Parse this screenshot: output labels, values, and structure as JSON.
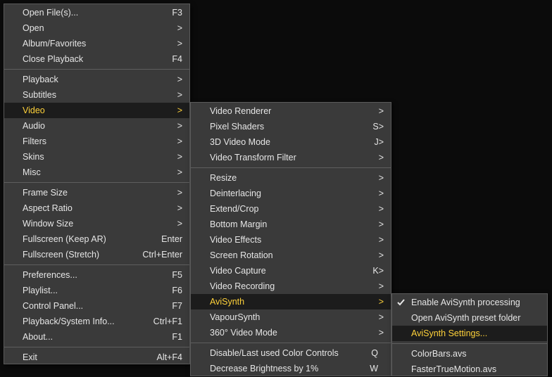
{
  "colors": {
    "background": "#0b0b0b",
    "menu_bg": "#3a3a3a",
    "highlight_bg": "#1c1c1c",
    "highlight_text": "#ffd23a",
    "text": "#e6e6e6"
  },
  "main_menu": {
    "open_files": {
      "label": "Open File(s)...",
      "shortcut": "F3"
    },
    "open": {
      "label": "Open",
      "arrow": ">"
    },
    "album_favorites": {
      "label": "Album/Favorites",
      "arrow": ">"
    },
    "close_playback": {
      "label": "Close Playback",
      "shortcut": "F4"
    },
    "playback": {
      "label": "Playback",
      "arrow": ">"
    },
    "subtitles": {
      "label": "Subtitles",
      "arrow": ">"
    },
    "video": {
      "label": "Video",
      "arrow": ">"
    },
    "audio": {
      "label": "Audio",
      "arrow": ">"
    },
    "filters": {
      "label": "Filters",
      "arrow": ">"
    },
    "skins": {
      "label": "Skins",
      "arrow": ">"
    },
    "misc": {
      "label": "Misc",
      "arrow": ">"
    },
    "frame_size": {
      "label": "Frame Size",
      "arrow": ">"
    },
    "aspect_ratio": {
      "label": "Aspect Ratio",
      "arrow": ">"
    },
    "window_size": {
      "label": "Window Size",
      "arrow": ">"
    },
    "fullscreen_keep_ar": {
      "label": "Fullscreen (Keep AR)",
      "shortcut": "Enter"
    },
    "fullscreen_stretch": {
      "label": "Fullscreen (Stretch)",
      "shortcut": "Ctrl+Enter"
    },
    "preferences": {
      "label": "Preferences...",
      "shortcut": "F5"
    },
    "playlist": {
      "label": "Playlist...",
      "shortcut": "F6"
    },
    "control_panel": {
      "label": "Control Panel...",
      "shortcut": "F7"
    },
    "playback_system_info": {
      "label": "Playback/System Info...",
      "shortcut": "Ctrl+F1"
    },
    "about": {
      "label": "About...",
      "shortcut": "F1"
    },
    "exit": {
      "label": "Exit",
      "shortcut": "Alt+F4"
    }
  },
  "video_menu": {
    "video_renderer": {
      "label": "Video Renderer",
      "arrow": ">"
    },
    "pixel_shaders": {
      "label": "Pixel Shaders",
      "shortcut": "S>"
    },
    "video_mode_3d": {
      "label": "3D Video Mode",
      "shortcut": "J>"
    },
    "video_transform_filter": {
      "label": "Video Transform Filter",
      "arrow": ">"
    },
    "resize": {
      "label": "Resize",
      "arrow": ">"
    },
    "deinterlacing": {
      "label": "Deinterlacing",
      "arrow": ">"
    },
    "extend_crop": {
      "label": "Extend/Crop",
      "arrow": ">"
    },
    "bottom_margin": {
      "label": "Bottom Margin",
      "arrow": ">"
    },
    "video_effects": {
      "label": "Video Effects",
      "arrow": ">"
    },
    "screen_rotation": {
      "label": "Screen Rotation",
      "arrow": ">"
    },
    "video_capture": {
      "label": "Video Capture",
      "shortcut": "K>"
    },
    "video_recording": {
      "label": "Video Recording",
      "arrow": ">"
    },
    "avisynth": {
      "label": "AviSynth",
      "arrow": ">"
    },
    "vapoursynth": {
      "label": "VapourSynth",
      "arrow": ">"
    },
    "video_mode_360": {
      "label": "360° Video Mode",
      "arrow": ">"
    },
    "disable_color_controls": {
      "label": "Disable/Last used Color Controls",
      "shortcut": "Q"
    },
    "decrease_brightness": {
      "label": "Decrease Brightness by 1%",
      "shortcut": "W"
    }
  },
  "avisynth_menu": {
    "enable_processing": {
      "label": "Enable AviSynth processing",
      "checked": true,
      "icon": "checkmark-icon"
    },
    "open_preset_folder": {
      "label": "Open AviSynth preset folder"
    },
    "settings": {
      "label": "AviSynth Settings..."
    },
    "colorbars": {
      "label": "ColorBars.avs"
    },
    "fastertruemotion": {
      "label": "FasterTrueMotion.avs"
    }
  }
}
